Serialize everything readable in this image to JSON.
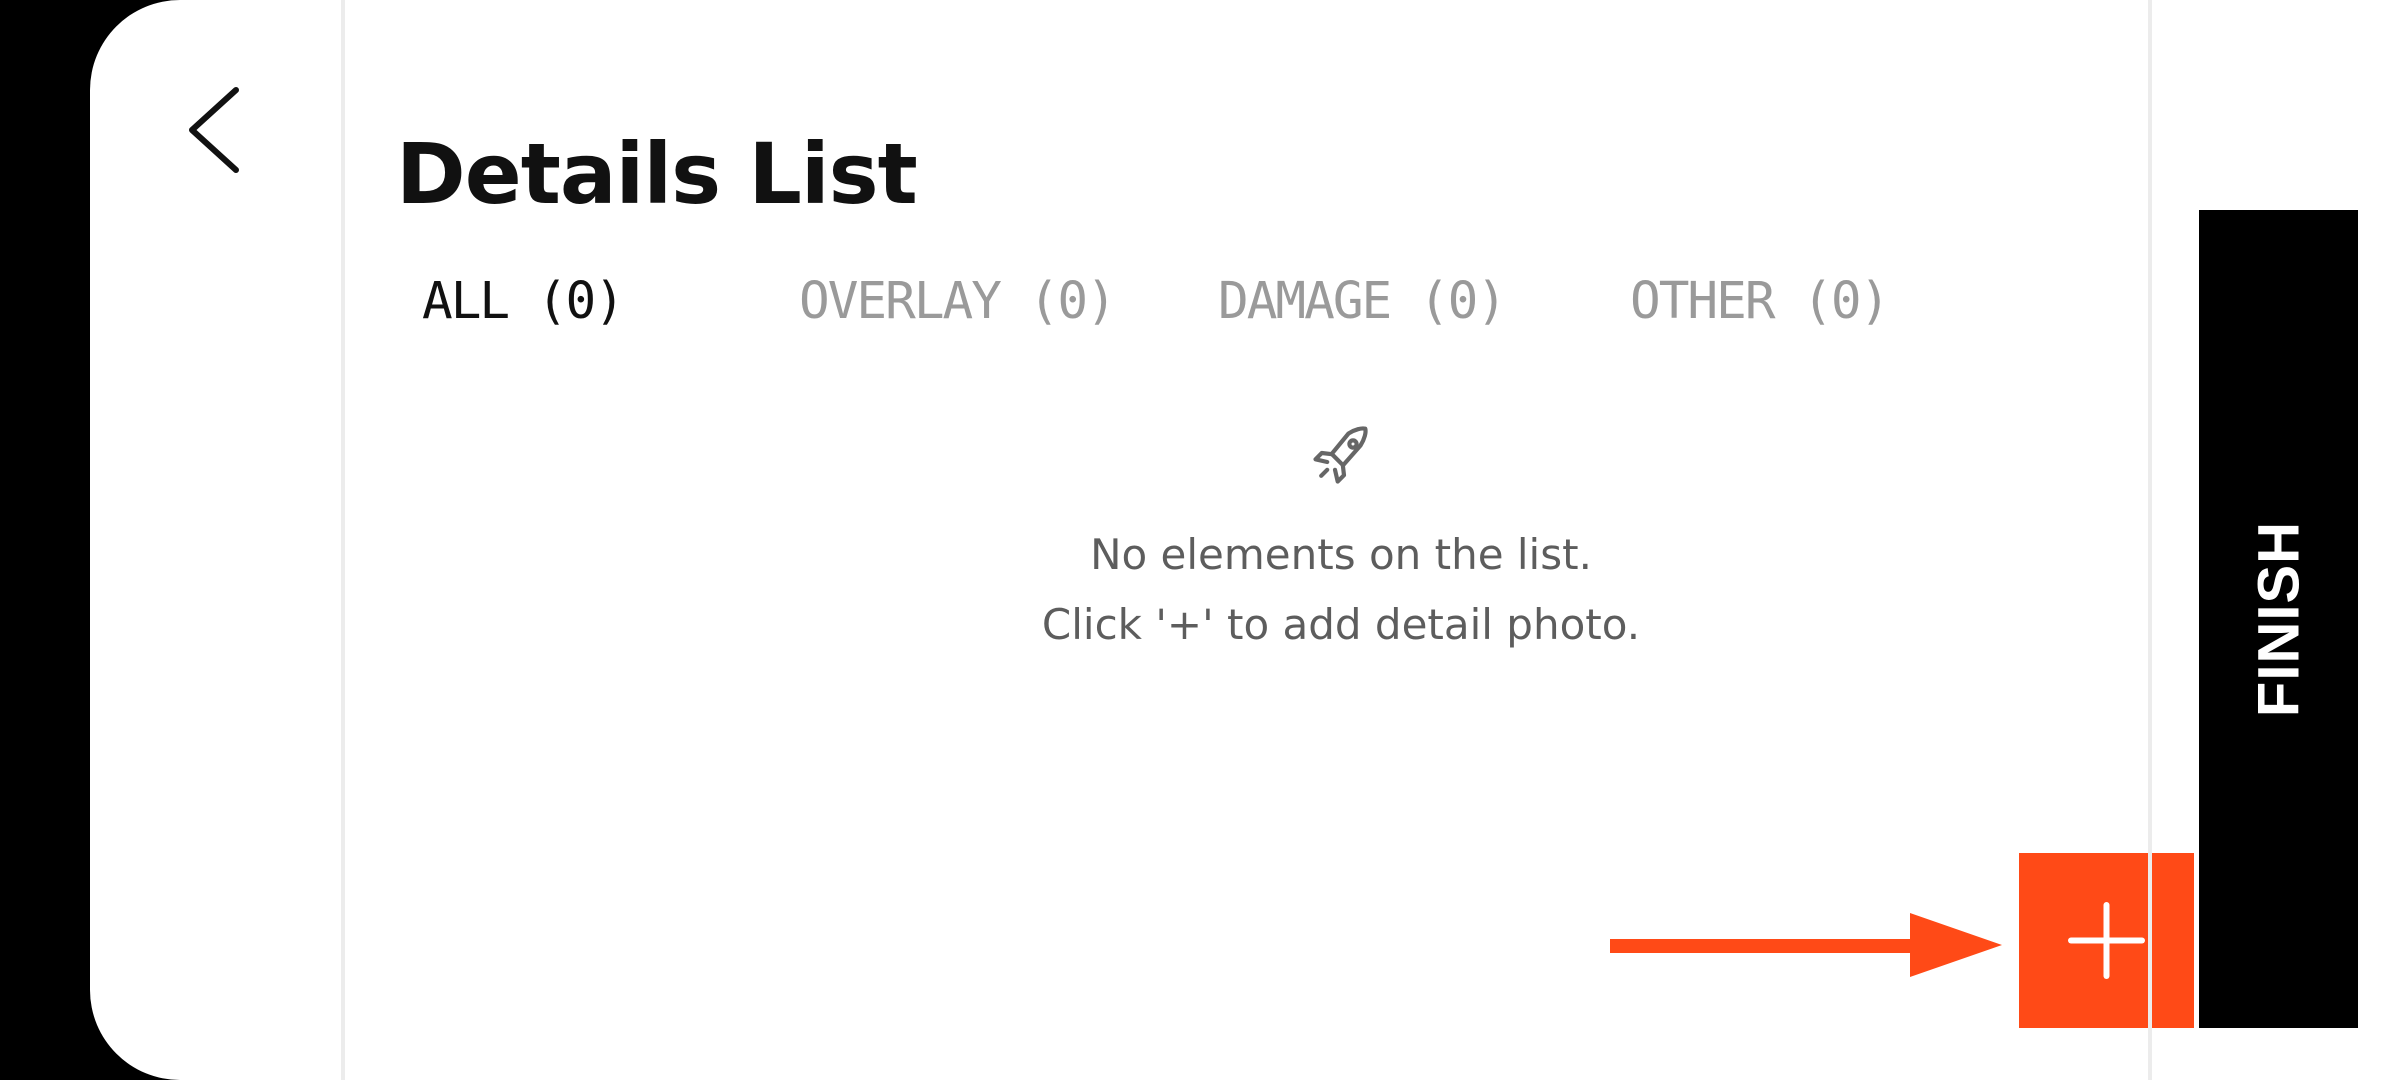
{
  "header": {
    "title": "Details List"
  },
  "tabs": [
    {
      "label": "ALL (0)",
      "active": true
    },
    {
      "label": "OVERLAY (0)",
      "active": false
    },
    {
      "label": "DAMAGE (0)",
      "active": false
    },
    {
      "label": "OTHER (0)",
      "active": false
    }
  ],
  "empty_state": {
    "icon": "rocket-icon",
    "line1": "No elements on the list.",
    "line2": "Click '+' to add detail photo."
  },
  "actions": {
    "add_icon": "plus-icon",
    "finish_label": "FINISH",
    "back_icon": "chevron-left-icon",
    "hint_icon": "arrow-right-icon"
  },
  "colors": {
    "accent": "#ff4a17",
    "active_tab": "#111111",
    "inactive_tab": "#9a9a9a",
    "background": "#ffffff",
    "finish_background": "#000000"
  }
}
